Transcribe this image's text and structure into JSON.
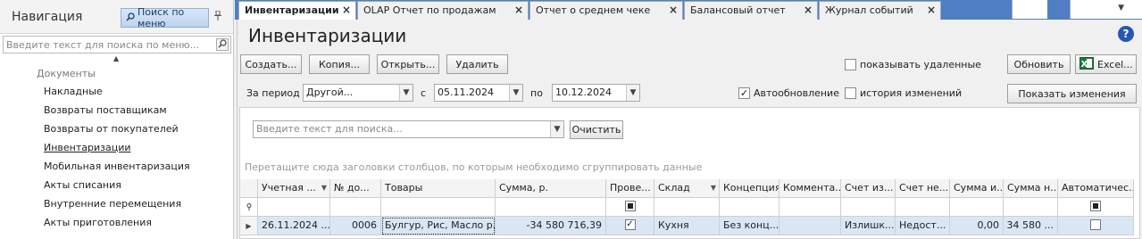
{
  "sidebar": {
    "title": "Навигация",
    "search_button": "Поиск по меню",
    "search_placeholder": "Введите текст для поиска по меню...",
    "group": "Документы",
    "items": [
      {
        "label": "Накладные"
      },
      {
        "label": "Возвраты поставщикам"
      },
      {
        "label": "Возвраты от покупателей"
      },
      {
        "label": "Инвентаризации"
      },
      {
        "label": "Мобильная инвентаризация"
      },
      {
        "label": "Акты списания"
      },
      {
        "label": "Внутренние перемещения"
      },
      {
        "label": "Акты приготовления"
      }
    ],
    "active_index": 3
  },
  "tabs": [
    {
      "label": "Инвентаризации",
      "active": true
    },
    {
      "label": "OLAP Отчет по продажам"
    },
    {
      "label": "Отчет о среднем чеке"
    },
    {
      "label": "Балансовый отчет"
    },
    {
      "label": "Журнал событий"
    }
  ],
  "page": {
    "title": "Инвентаризации",
    "toolbar": {
      "create": "Создать...",
      "copy": "Копия...",
      "open": "Открыть...",
      "delete": "Удалить",
      "show_deleted": "показывать удаленные",
      "refresh": "Обновить",
      "excel": "Excel..."
    },
    "period": {
      "label": "За период",
      "value": "Другой...",
      "from_label": "с",
      "from": "05.11.2024",
      "to_label": "по",
      "to": "10.12.2024",
      "autoupdate": "Автообновление",
      "autoupdate_checked": true,
      "history": "история изменений",
      "history_checked": false,
      "show_changes": "Показать изменения"
    },
    "search_placeholder": "Введите текст для поиска...",
    "clear": "Очистить",
    "group_hint": "Перетащите сюда заголовки столбцов, по которым необходимо сгруппировать данные"
  },
  "grid": {
    "headers": [
      "Учетная ...",
      "№ до...",
      "Товары",
      "Сумма, р.",
      "Прове...",
      "Склад",
      "Концепция",
      "Коммента...",
      "Счет из...",
      "Счет не...",
      "Сумма и...",
      "Сумма н...",
      "Автоматичес..."
    ],
    "rows": [
      {
        "date": "26.11.2024 ...",
        "number": "0006",
        "goods": "Булгур, Рис, Масло р...",
        "sum": "-34 580 716,39",
        "checked": true,
        "store": "Кухня",
        "concept": "Без конц...",
        "comment": "",
        "acc_surplus": "Излишк...",
        "acc_shortage": "Недост...",
        "sum_surplus": "0,00",
        "sum_shortage": "34 580 ...",
        "auto": false
      }
    ]
  },
  "colors": {
    "tabbar": "#4f7fc2",
    "selected_row": "#dbe6f5",
    "nav_search_btn": "#c6dbf1"
  }
}
